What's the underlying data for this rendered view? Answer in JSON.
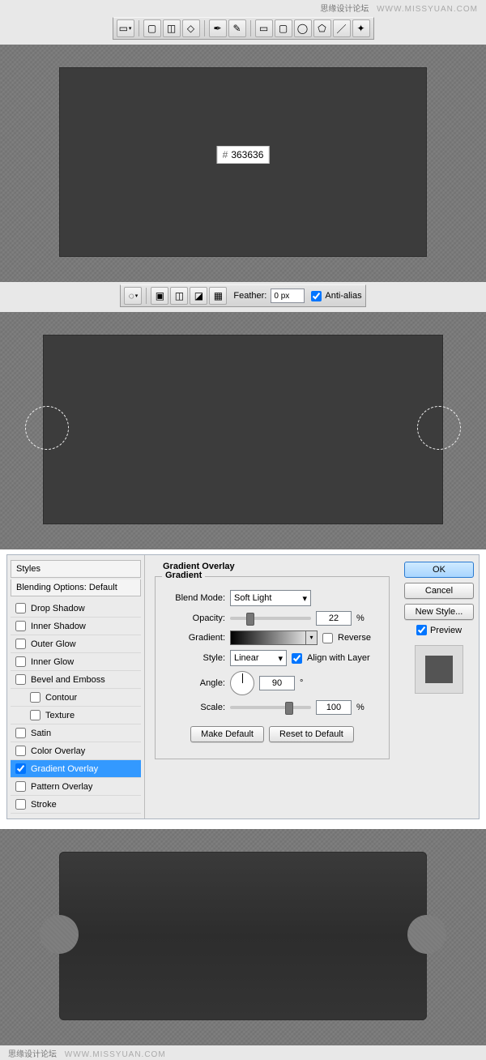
{
  "watermark": {
    "site": "思缘设计论坛",
    "url": "WWW.MISSYUAN.COM"
  },
  "toolbar_top": {
    "icons": [
      "rectangle",
      "separator",
      "path-sel",
      "subtract",
      "intersect",
      "separator",
      "pen",
      "freeform-pen",
      "separator",
      "rect",
      "rounded-rect",
      "ellipse",
      "polygon",
      "line",
      "custom-shape"
    ]
  },
  "toolbar_mid": {
    "icons": [
      "ellipse-marq",
      "separator",
      "new-sel",
      "add-sel",
      "subtract-sel",
      "intersect-sel"
    ],
    "feather_label": "Feather:",
    "feather_value": "0 px",
    "antialias_label": "Anti-alias",
    "antialias_checked": true
  },
  "color_swatch": {
    "hash": "#",
    "hex": "363636"
  },
  "layer_style": {
    "title": "Gradient Overlay",
    "styles_header": "Styles",
    "blending_header": "Blending Options: Default",
    "items": [
      {
        "label": "Drop Shadow",
        "checked": false
      },
      {
        "label": "Inner Shadow",
        "checked": false
      },
      {
        "label": "Outer Glow",
        "checked": false
      },
      {
        "label": "Inner Glow",
        "checked": false
      },
      {
        "label": "Bevel and Emboss",
        "checked": false
      },
      {
        "label": "Contour",
        "checked": false,
        "indent": true
      },
      {
        "label": "Texture",
        "checked": false,
        "indent": true
      },
      {
        "label": "Satin",
        "checked": false
      },
      {
        "label": "Color Overlay",
        "checked": false
      },
      {
        "label": "Gradient Overlay",
        "checked": true,
        "selected": true
      },
      {
        "label": "Pattern Overlay",
        "checked": false
      },
      {
        "label": "Stroke",
        "checked": false
      }
    ],
    "gradient_group": "Gradient",
    "blend_mode_label": "Blend Mode:",
    "blend_mode_value": "Soft Light",
    "opacity_label": "Opacity:",
    "opacity_value": "22",
    "percent": "%",
    "gradient_label": "Gradient:",
    "reverse_label": "Reverse",
    "reverse_checked": false,
    "style_label": "Style:",
    "style_value": "Linear",
    "align_label": "Align with Layer",
    "align_checked": true,
    "angle_label": "Angle:",
    "angle_value": "90",
    "degree": "°",
    "scale_label": "Scale:",
    "scale_value": "100",
    "make_default": "Make Default",
    "reset_default": "Reset to Default",
    "ok": "OK",
    "cancel": "Cancel",
    "new_style": "New Style...",
    "preview_label": "Preview",
    "preview_checked": true
  }
}
